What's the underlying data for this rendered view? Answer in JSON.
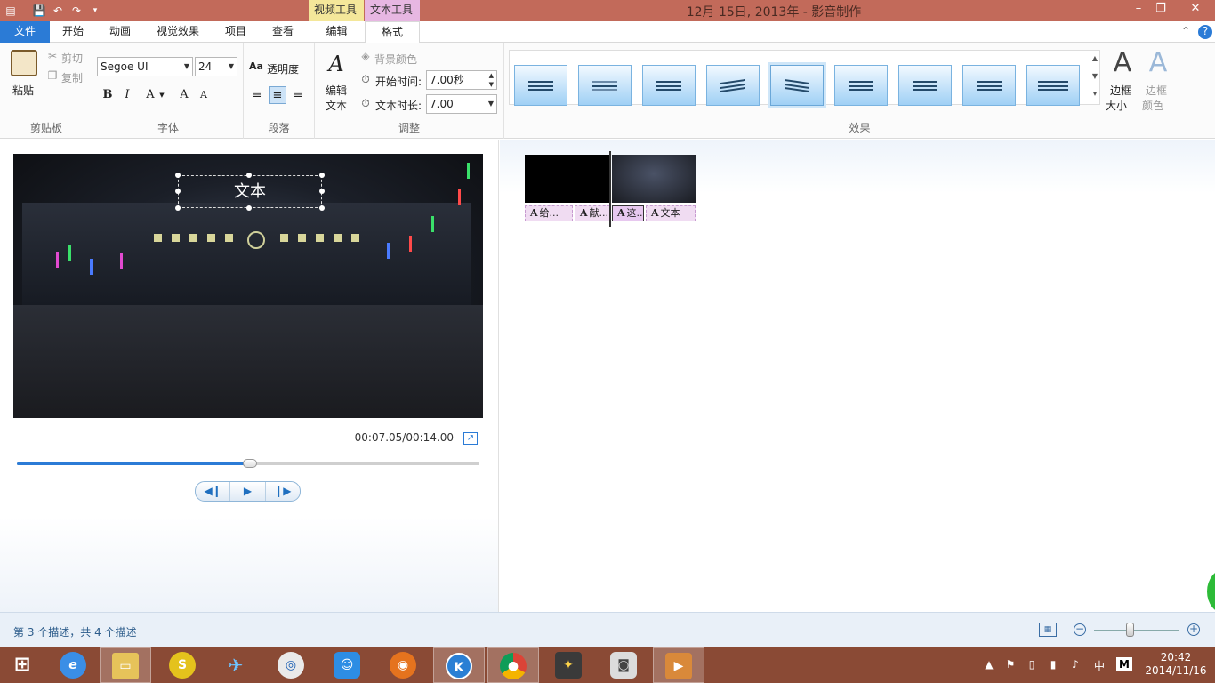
{
  "window": {
    "title": "12月 15日, 2013年 - 影音制作",
    "context_tab_video": "视频工具",
    "context_tab_text": "文本工具"
  },
  "tabs": {
    "file": "文件",
    "home": "开始",
    "animation": "动画",
    "visual_effects": "视觉效果",
    "project": "项目",
    "view": "查看",
    "edit": "编辑",
    "format": "格式"
  },
  "ribbon": {
    "clipboard": {
      "paste": "粘贴",
      "cut": "剪切",
      "copy": "复制",
      "group": "剪贴板"
    },
    "font": {
      "family": "Segoe UI",
      "size": "24",
      "bold": "B",
      "italic": "I",
      "color": "A",
      "grow": "A",
      "shrink": "A",
      "group": "字体"
    },
    "paragraph": {
      "transparency": "透明度",
      "group": "段落"
    },
    "adjust": {
      "edit_text_line1": "编辑",
      "edit_text_line2": "文本",
      "bg_color": "背景颜色",
      "start_time_label": "开始时间:",
      "start_time_value": "7.00秒",
      "duration_label": "文本时长:",
      "duration_value": "7.00",
      "group": "调整"
    },
    "effects": {
      "group": "效果",
      "selected_index": 4,
      "outline_size_line1": "边框",
      "outline_size_line2": "大小",
      "outline_color_line1": "边框",
      "outline_color_line2": "颜色"
    }
  },
  "preview": {
    "overlay_text": "文本",
    "time": "00:07.05/00:14.00",
    "seek_fraction": 0.5035
  },
  "storyboard": {
    "captions": [
      {
        "icon": "A",
        "text": "给..."
      },
      {
        "icon": "A",
        "text": "献..."
      },
      {
        "icon": "A",
        "text": "这..."
      },
      {
        "icon": "A",
        "text": "文本"
      }
    ]
  },
  "status": {
    "text": "第 3 个描述，共 4 个描述"
  },
  "taskbar": {
    "ime": "中",
    "time": "20:42",
    "date": "2014/11/16"
  }
}
